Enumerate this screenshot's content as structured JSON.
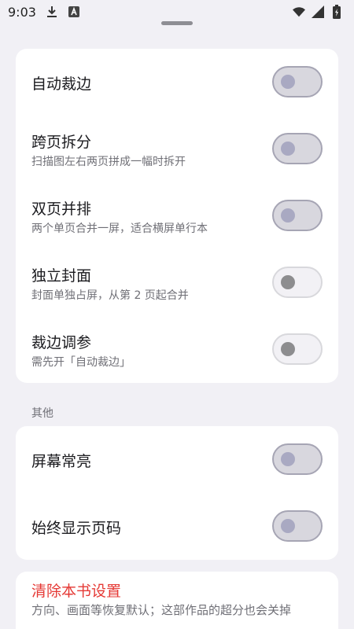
{
  "status_bar": {
    "time": "9:03",
    "icons_left": [
      "download-icon",
      "keyboard-a-icon"
    ],
    "icons_right": [
      "wifi-icon",
      "signal-icon",
      "battery-icon"
    ]
  },
  "card_main": {
    "rows": [
      {
        "title": "自动裁边",
        "subtitle": "",
        "switch_state": "disabled"
      },
      {
        "title": "跨页拆分",
        "subtitle": "扫描图左右两页拼成一幅时拆开",
        "switch_state": "disabled"
      },
      {
        "title": "双页并排",
        "subtitle": "两个单页合并一屏，适合横屏单行本",
        "switch_state": "disabled"
      },
      {
        "title": "独立封面",
        "subtitle": "封面单独占屏，从第 2 页起合并",
        "switch_state": "off"
      },
      {
        "title": "裁边调参",
        "subtitle": "需先开「自动裁边」",
        "switch_state": "off"
      }
    ]
  },
  "section_other": {
    "label": "其他",
    "rows": [
      {
        "title": "屏幕常亮",
        "switch_state": "disabled"
      },
      {
        "title": "始终显示页码",
        "switch_state": "disabled"
      }
    ]
  },
  "reset": {
    "title": "清除本书设置",
    "subtitle": "方向、画面等恢复默认；这部作品的超分也会关掉"
  },
  "colors": {
    "background": "#f1f0f5",
    "card": "#ffffff",
    "danger": "#e53935",
    "switch_disabled_track": "#d8d7de",
    "switch_disabled_knob": "#a9a9c2",
    "switch_off_knob": "#8d8d8f"
  }
}
